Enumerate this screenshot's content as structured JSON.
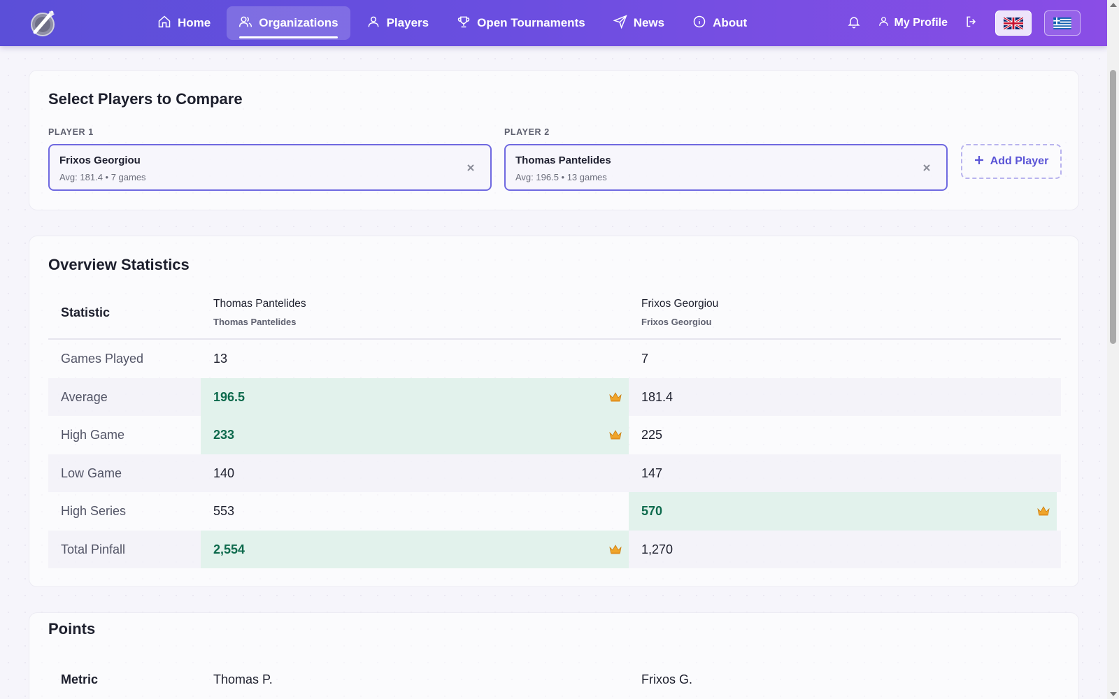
{
  "nav": {
    "items": [
      {
        "label": "Home",
        "icon": "home-icon"
      },
      {
        "label": "Organizations",
        "icon": "users-icon",
        "active": true
      },
      {
        "label": "Players",
        "icon": "user-icon"
      },
      {
        "label": "Open Tournaments",
        "icon": "trophy-icon"
      },
      {
        "label": "News",
        "icon": "send-icon"
      },
      {
        "label": "About",
        "icon": "info-icon"
      }
    ],
    "profile_label": "My Profile",
    "languages": [
      "English",
      "Greek"
    ],
    "active_language": "English"
  },
  "select": {
    "title": "Select Players to Compare",
    "player1": {
      "label": "PLAYER 1",
      "name": "Frixos Georgiou",
      "meta": "Avg: 181.4 • 7 games"
    },
    "player2": {
      "label": "PLAYER 2",
      "name": "Thomas Pantelides",
      "meta": "Avg: 196.5 • 13 games"
    },
    "add_label": "Add Player"
  },
  "overview": {
    "title": "Overview Statistics",
    "header": {
      "stat": "Statistic",
      "col1": {
        "name": "Thomas Pantelides",
        "sub": "Thomas Pantelides"
      },
      "col2": {
        "name": "Frixos Georgiou",
        "sub": "Frixos Georgiou"
      }
    },
    "rows": [
      {
        "label": "Games Played",
        "v1": "13",
        "v2": "7",
        "winner": null
      },
      {
        "label": "Average",
        "v1": "196.5",
        "v2": "181.4",
        "winner": 1
      },
      {
        "label": "High Game",
        "v1": "233",
        "v2": "225",
        "winner": 1
      },
      {
        "label": "Low Game",
        "v1": "140",
        "v2": "147",
        "winner": null
      },
      {
        "label": "High Series",
        "v1": "553",
        "v2": "570",
        "winner": 2
      },
      {
        "label": "Total Pinfall",
        "v1": "2,554",
        "v2": "1,270",
        "winner": 1
      }
    ]
  },
  "points": {
    "title": "Points",
    "header": {
      "metric": "Metric",
      "col1": "Thomas P.",
      "col2": "Frixos G."
    }
  },
  "colors": {
    "nav_gradient_start": "#5b4fd8",
    "nav_gradient_end": "#8a4de6",
    "accent": "#6f69e0",
    "win_bg": "#e2f2ec",
    "win_text": "#0d6a4c"
  }
}
